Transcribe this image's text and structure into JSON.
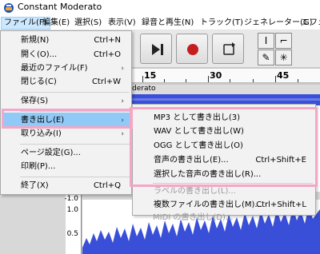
{
  "window": {
    "title": "Constant Moderato"
  },
  "menubar": [
    {
      "label": "ファイル(F)",
      "active": true
    },
    {
      "label": "編集(E)"
    },
    {
      "label": "選択(S)"
    },
    {
      "label": "表示(V)"
    },
    {
      "label": "録音と再生(N)"
    },
    {
      "label": "トラック(T)"
    },
    {
      "label": "ジェネレーター(G)"
    },
    {
      "label": "エフェク"
    }
  ],
  "toolbar": {
    "play_icon": "skip-to-end-icon",
    "record_icon": "record-icon",
    "loop_icon": "loop-icon",
    "tools": [
      "I",
      "⌐",
      "✎",
      "✳"
    ]
  },
  "ruler": {
    "labels": [
      "15",
      "30",
      "45"
    ]
  },
  "track": {
    "name": "derato",
    "scale": [
      "-1.0",
      "1.0",
      "0.5"
    ]
  },
  "file_menu": {
    "items": [
      {
        "label": "新規(N)",
        "shortcut": "Ctrl+N"
      },
      {
        "label": "開く(O)...",
        "shortcut": "Ctrl+O"
      },
      {
        "label": "最近のファイル(F)",
        "submenu": true
      },
      {
        "label": "閉じる(C)",
        "shortcut": "Ctrl+W"
      },
      {
        "label": "保存(S)",
        "submenu": true
      },
      {
        "label": "書き出し(E)",
        "submenu": true,
        "highlighted": true
      },
      {
        "label": "取り込み(I)",
        "submenu": true
      },
      {
        "label": "ページ設定(G)..."
      },
      {
        "label": "印刷(P)..."
      },
      {
        "label": "終了(X)",
        "shortcut": "Ctrl+Q"
      }
    ]
  },
  "export_submenu": {
    "items": [
      {
        "label": "MP3 として書き出し(3)"
      },
      {
        "label": "WAV として書き出し(W)"
      },
      {
        "label": "OGG として書き出し(O)"
      },
      {
        "label": "音声の書き出し(E)...",
        "shortcut": "Ctrl+Shift+E"
      },
      {
        "label": "選択した音声の書き出し(R)..."
      },
      {
        "label": "ラベルの書き出し(L)...",
        "disabled": true
      },
      {
        "label": "複数ファイルの書き出し(M)...",
        "shortcut": "Ctrl+Shift+L"
      },
      {
        "label": "MIDI の書き出し(D)...",
        "disabled": true
      }
    ]
  },
  "colors": {
    "highlight": "#91c9f7",
    "annotation_frame": "#f4a6c6",
    "waveform": "#3a4fd8",
    "record_dot": "#c41e1e"
  }
}
